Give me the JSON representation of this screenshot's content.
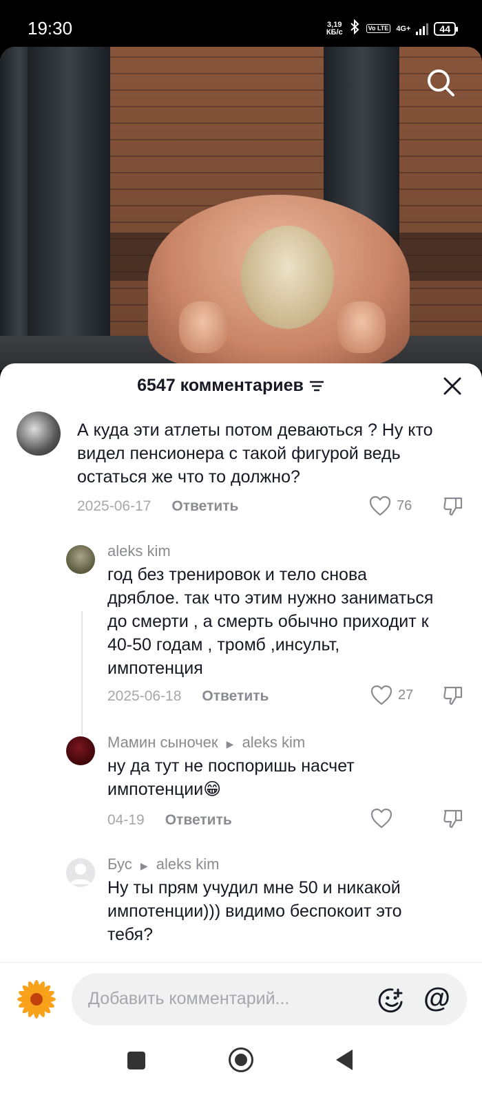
{
  "status_bar": {
    "time": "19:30",
    "net_speed_value": "3,19",
    "net_speed_unit": "КБ/с",
    "lte_label": "Vo LTE",
    "network": "4G+",
    "battery": "44"
  },
  "comments_panel": {
    "title": "6547 комментариев",
    "close_icon": "close-icon",
    "filter_icon": "sort-filter-icon"
  },
  "comments": [
    {
      "username": "",
      "text": "А куда эти атлеты потом деваються ? Ну кто видел пенсионера с такой фигурой ведь остаться же что то должно?",
      "date": "2025-06-17",
      "reply_label": "Ответить",
      "likes": "76"
    },
    {
      "username": "aleks kim",
      "text": "год без тренировок и тело снова дряблое. так что этим нужно заниматься до смерти , а смерть обычно приходит к 40-50 годам , тромб ,инсульт, импотенция",
      "date": "2025-06-18",
      "reply_label": "Ответить",
      "likes": "27"
    },
    {
      "username": "Мамин сыночек",
      "reply_to": "aleks kim",
      "text": "ну да тут не поспоришь насчет импотенции😁",
      "date": "04-19",
      "reply_label": "Ответить",
      "likes": ""
    },
    {
      "username": "Бус",
      "reply_to": "aleks kim",
      "text": "Ну ты прям учудил мне 50 и никакой импотенции))) видимо беспокоит это тебя?",
      "date": "",
      "reply_label": "",
      "likes": ""
    }
  ],
  "input": {
    "placeholder": "Добавить комментарий...",
    "at_label": "@"
  },
  "colors": {
    "text_primary": "#161823",
    "text_secondary": "#8a8b91",
    "meta": "#a6a7ab"
  }
}
